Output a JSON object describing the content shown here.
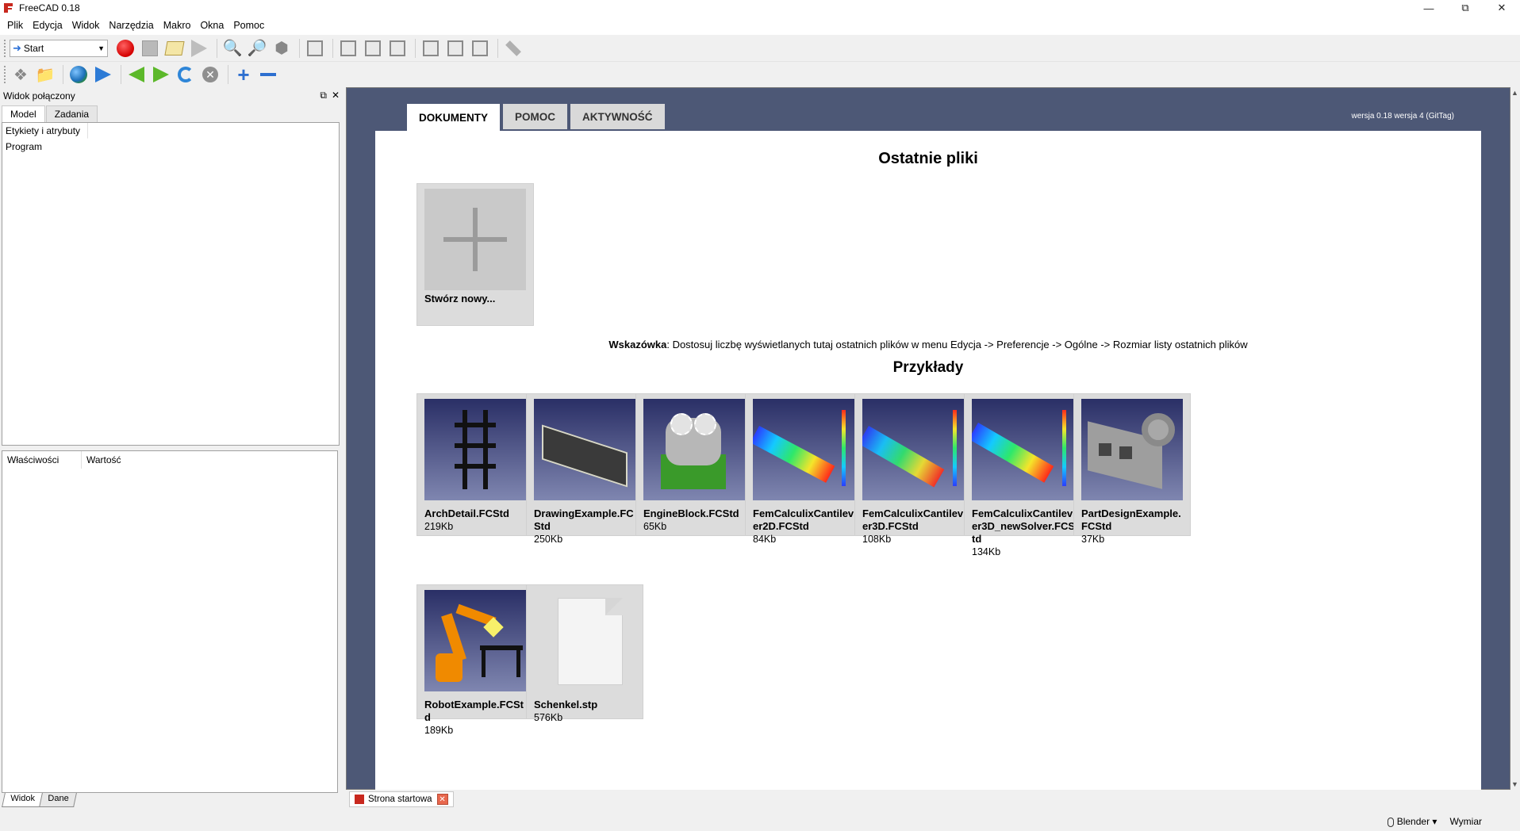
{
  "window": {
    "title": "FreeCAD 0.18"
  },
  "menu": [
    "Plik",
    "Edycja",
    "Widok",
    "Narzędzia",
    "Makro",
    "Okna",
    "Pomoc"
  ],
  "toolbar": {
    "workbench": "Start"
  },
  "dock": {
    "title": "Widok połączony",
    "tabs": [
      "Model",
      "Zadania"
    ],
    "tree_header": "Etykiety i atrybuty",
    "tree_items": [
      "Program"
    ],
    "prop_headers": [
      "Właściwości",
      "Wartość"
    ],
    "bottom_tabs": [
      "Widok",
      "Dane"
    ]
  },
  "start": {
    "tabs": [
      "DOKUMENTY",
      "POMOC",
      "AKTYWNOŚĆ"
    ],
    "version": "wersja 0.18 wersja 4 (GitTag)",
    "recent_title": "Ostatnie pliki",
    "new_label": "Stwórz nowy...",
    "tip_bold": "Wskazówka",
    "tip_text": ": Dostosuj liczbę wyświetlanych tutaj ostatnich plików w menu Edycja -> Preferencje -> Ogólne -> Rozmiar listy ostatnich plików",
    "examples_title": "Przykłady",
    "examples": [
      {
        "name": "ArchDetail.FCStd",
        "size": "219Kb"
      },
      {
        "name": "DrawingExample.FCStd",
        "size": "250Kb"
      },
      {
        "name": "EngineBlock.FCStd",
        "size": "65Kb"
      },
      {
        "name": "FemCalculixCantilever2D.FCStd",
        "size": "84Kb"
      },
      {
        "name": "FemCalculixCantilever3D.FCStd",
        "size": "108Kb"
      },
      {
        "name": "FemCalculixCantilever3D_newSolver.FCStd",
        "size": "134Kb"
      },
      {
        "name": "PartDesignExample.FCStd",
        "size": "37Kb"
      },
      {
        "name": "RobotExample.FCStd",
        "size": "189Kb"
      },
      {
        "name": "Schenkel.stp",
        "size": "576Kb"
      }
    ]
  },
  "doc_tab": {
    "label": "Strona startowa"
  },
  "status": {
    "nav_style": "Blender",
    "dimension": "Wymiar"
  }
}
